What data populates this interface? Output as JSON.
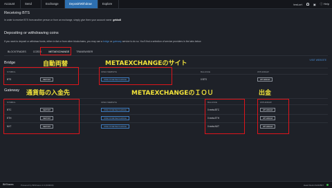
{
  "nav": {
    "tabs": [
      "Account",
      "Send",
      "Exchange",
      "Deposit/Withdraw",
      "Explore"
    ],
    "active_index": 3,
    "user": "test-ort",
    "help": "Help"
  },
  "receive": {
    "title": "Receiving BTS",
    "text_prefix": "In order to receive BTS from another person or from an exchange, simply give them your account name:",
    "account": "gekko8"
  },
  "deposit": {
    "title": "Depositing or withdrawing coins",
    "text_a": "If you want to deposit or withdraw funds, either in fiat or from other blockchains, you may use a",
    "link1": "bridge",
    "text_b": "or",
    "link2": "gateway",
    "text_c": "service to do so. You'll find a selection of service providers in the tabs below"
  },
  "provider_tabs": [
    "BLOCKTRADES",
    "CCEDK",
    "METAEXCHANGE",
    "TRANSWISER"
  ],
  "active_provider": 2,
  "visit_website": "VISIT WEBSITE",
  "bridge": {
    "title": "Bridge",
    "headers": {
      "symbol": "SYMBOL",
      "open": "OPEN WEBSITE",
      "balance": "BALANCE",
      "withdraw": "WITHDRAW"
    },
    "row": {
      "symbol": "BTS",
      "deposit": "DEPOSIT",
      "open": "OPEN IN METAEXCHANGE",
      "balance": "0 BTS",
      "withdraw": "WITHDRAW"
    }
  },
  "gateway": {
    "title": "Gateway",
    "headers": {
      "symbol": "SYMBOL",
      "open": "OPEN WEBSITE",
      "balance": "BALANCE",
      "withdraw": "WITHDRAW"
    },
    "rows": [
      {
        "symbol": "BTC",
        "deposit": "DEPOSIT",
        "open": "OPEN IN METAEXCHANGE",
        "balance": "0 meta.BTC",
        "withdraw": "WITHDRAW"
      },
      {
        "symbol": "ETH",
        "deposit": "DEPOSIT",
        "open": "OPEN IN METAEXCHANGE",
        "balance": "0 meta.ETH",
        "withdraw": "WITHDRAW"
      },
      {
        "symbol": "NXT",
        "deposit": "DEPOSIT",
        "open": "OPEN IN METAEXCHANGE",
        "balance": "0 meta.NXT",
        "withdraw": "WITHDRAW"
      }
    ]
  },
  "annotations": {
    "auto": "自動両替",
    "site": "METAEXCHANGEのサイト",
    "per_coin": "通貨毎の入金先",
    "iou": "METAEXCHANGEのＩＯＵ",
    "withdraw": "出金"
  },
  "footer": {
    "brand": "BitShares",
    "powered": "Powered by BitShares 2.0 (000000)",
    "head_block": "Head block #1234567"
  },
  "colors": {
    "accent": "#2d6fb0",
    "annotation_box": "#e0141a",
    "annotation_text": "#f1e23a"
  }
}
